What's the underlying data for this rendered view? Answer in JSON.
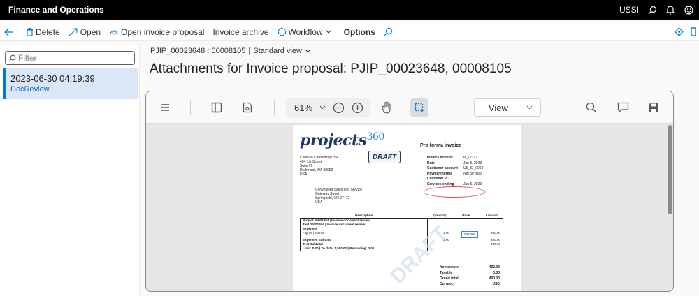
{
  "app": {
    "title": "Finance and Operations",
    "company": "USSI"
  },
  "actions": {
    "delete": "Delete",
    "open": "Open",
    "open_invoice_proposal": "Open invoice proposal",
    "invoice_archive": "Invoice archive",
    "workflow": "Workflow",
    "options": "Options"
  },
  "left": {
    "filter_placeholder": "Filter",
    "items": [
      {
        "title": "2023-06-30 04:19:39",
        "subtitle": "DocReview"
      }
    ]
  },
  "breadcrumb": {
    "record": "PJIP_00023648 : 00008105",
    "separator": "|",
    "view": "Standard view"
  },
  "page_title": "Attachments for Invoice proposal: PJIP_00023648, 00008105",
  "viewer": {
    "zoom": "61%",
    "view_select": "View"
  },
  "document": {
    "logo_text": "projects",
    "logo_num": "360",
    "draft": "DRAFT",
    "title": "Pro forma invoice",
    "from_address": [
      "Contoso Consulting USA",
      "454 1st Street",
      "Suite 99",
      "Redmond, WA 98052",
      "USA"
    ],
    "to_address": [
      "Convenient Sales and Service",
      "Gateway Street",
      "Springfield, OR 97477",
      "USA"
    ],
    "meta": [
      {
        "k": "Invoice number",
        "v": "P_12797"
      },
      {
        "k": "Date",
        "v": "Jun 5, 2023"
      },
      {
        "k": "Customer account",
        "v": "US_SI_0069"
      },
      {
        "k": "Payment terms",
        "v": "Net 30 days"
      },
      {
        "k": "Customer PO",
        "v": ""
      },
      {
        "k": "Services ending",
        "v": "Jun 5, 2023"
      }
    ],
    "table": {
      "headers": [
        "Description",
        "Quantity",
        "Price",
        "Amount"
      ],
      "rows": [
        {
          "desc": "Project 00001394 | Invoice document review",
          "bold": true,
          "qty": "",
          "price": "",
          "amount": ""
        },
        {
          "desc": "Test 00001394 | Invoice document review",
          "bold": true,
          "qty": "",
          "price": "",
          "amount": ""
        },
        {
          "desc": "Expenses",
          "bold": true,
          "qty": "",
          "price": "",
          "amount": ""
        },
        {
          "desc": "Flights | 200.00",
          "bold": false,
          "qty": "2.00",
          "price": "200.000",
          "amount": "400.00"
        },
        {
          "desc": "Expenses Subtotal",
          "bold": true,
          "qty": "2.00",
          "price": "",
          "amount": "400.00"
        },
        {
          "desc": "Test Subtotal",
          "bold": true,
          "qty": "",
          "price": "",
          "amount": "400.00"
        },
        {
          "desc": "Limit: 0.00 | To date: 1,500.00 | Remaining: 0.00",
          "bold": true,
          "qty": "",
          "price": "",
          "amount": ""
        }
      ]
    },
    "totals": [
      {
        "k": "Nontaxable",
        "v": "400.00"
      },
      {
        "k": "Taxable",
        "v": "0.00"
      },
      {
        "k": "Grand total",
        "v": "400.00"
      },
      {
        "k": "Currency",
        "v": "USD"
      }
    ]
  }
}
